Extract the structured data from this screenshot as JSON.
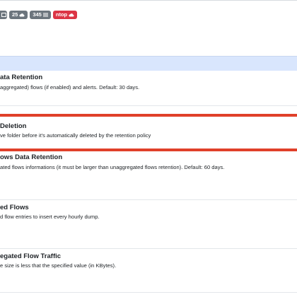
{
  "badges": [
    {
      "label": "",
      "icon": "window-icon",
      "color": "#6c757d"
    },
    {
      "label": "25",
      "icon": "cloud-icon",
      "color": "#6c757d"
    },
    {
      "label": "345",
      "icon": "list-icon",
      "color": "#6c757d"
    },
    {
      "label": "ntop",
      "icon": "cloud-icon",
      "color": "#dc3545"
    }
  ],
  "sections": [
    {
      "title": "ata Retention",
      "description": "aggregated) flows (if enabled) and alerts. Default: 30 days."
    },
    {
      "title": "Deletion",
      "description": "ve folder before it's automatically deleted by the retention policy"
    },
    {
      "title": "ows Data Retention",
      "description": "ated flows informations (it must be larger than unaggregated flows retention). Default: 60 days."
    },
    {
      "title": "ed Flows",
      "description": "d flow entries to insert every hourly dump."
    },
    {
      "title": "egated Flow Traffic",
      "description": "e size is less that the specified value (in KBytes)."
    }
  ],
  "colors": {
    "highlight": "#e0402a",
    "header_band": "#d9e6fd",
    "badge_gray": "#6c757d",
    "badge_red": "#dc3545"
  }
}
